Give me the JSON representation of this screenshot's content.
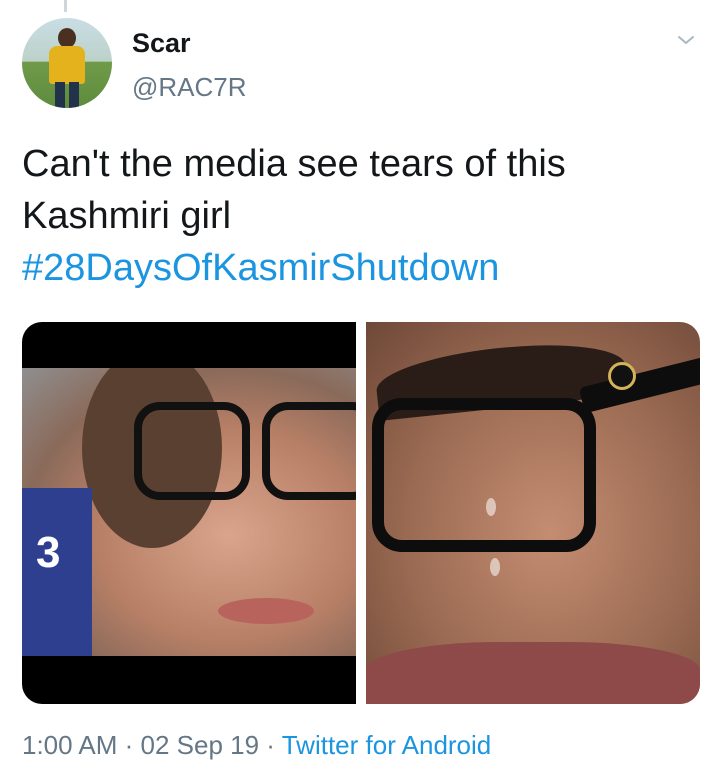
{
  "tweet": {
    "display_name": "Scar",
    "handle": "@RAC7R",
    "text_line1": "Can't the media see tears of this",
    "text_line2": "Kashmiri girl",
    "hashtag": "#28DaysOfKasmirShutdown",
    "time": "1:00 AM",
    "date": "02 Sep 19",
    "separator": " · ",
    "source": "Twitter for Android",
    "media_left_jersey_number": "3"
  },
  "colors": {
    "link": "#1b95e0",
    "secondary_text": "#657786",
    "primary_text": "#14171a"
  },
  "icons": {
    "menu_caret": "chevron-down-icon"
  }
}
